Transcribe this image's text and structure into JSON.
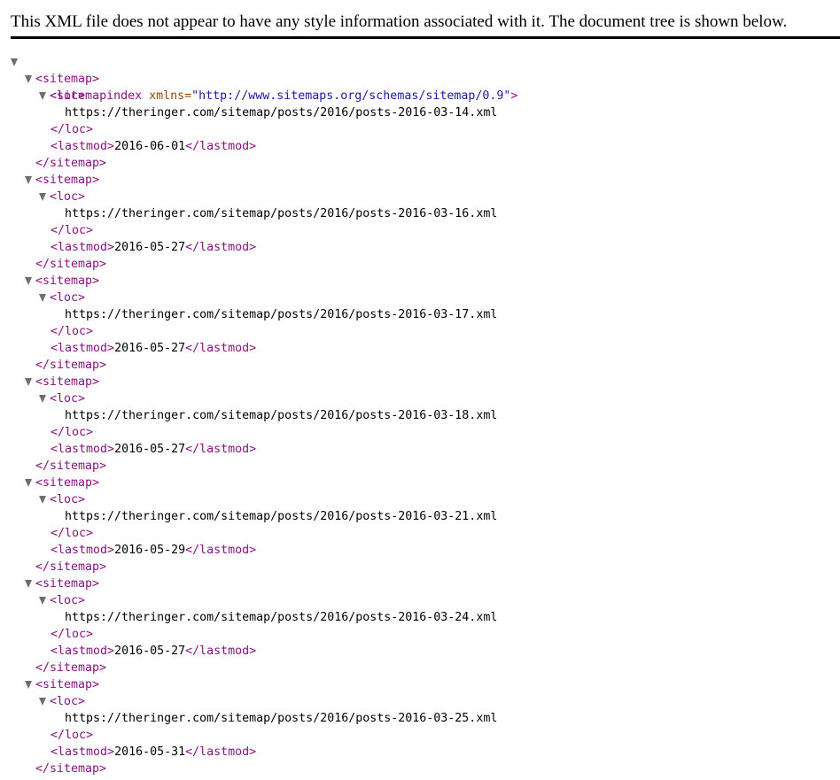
{
  "header": {
    "message": "This XML file does not appear to have any style information associated with it. The document tree is shown below."
  },
  "root": {
    "open_tag": "<sitemapindex",
    "attr_name": " xmlns=",
    "attr_value": "\"http://www.sitemaps.org/schemas/sitemap/0.9\"",
    "open_close": ">"
  },
  "tags": {
    "sitemap_open": "<sitemap>",
    "sitemap_close": "</sitemap>",
    "loc_open": "<loc>",
    "loc_close": "</loc>",
    "lastmod_open": "<lastmod>",
    "lastmod_close": "</lastmod>"
  },
  "sitemaps": [
    {
      "loc": "https://theringer.com/sitemap/posts/2016/posts-2016-03-14.xml",
      "lastmod": "2016-06-01"
    },
    {
      "loc": "https://theringer.com/sitemap/posts/2016/posts-2016-03-16.xml",
      "lastmod": "2016-05-27"
    },
    {
      "loc": "https://theringer.com/sitemap/posts/2016/posts-2016-03-17.xml",
      "lastmod": "2016-05-27"
    },
    {
      "loc": "https://theringer.com/sitemap/posts/2016/posts-2016-03-18.xml",
      "lastmod": "2016-05-27"
    },
    {
      "loc": "https://theringer.com/sitemap/posts/2016/posts-2016-03-21.xml",
      "lastmod": "2016-05-29"
    },
    {
      "loc": "https://theringer.com/sitemap/posts/2016/posts-2016-03-24.xml",
      "lastmod": "2016-05-27"
    },
    {
      "loc": "https://theringer.com/sitemap/posts/2016/posts-2016-03-25.xml",
      "lastmod": "2016-05-31"
    }
  ],
  "colors": {
    "tag": "#881280",
    "attribute_name": "#994500",
    "attribute_value": "#1a1aa6",
    "text": "#000000",
    "toggle_triangle": "#6e6e6e"
  }
}
